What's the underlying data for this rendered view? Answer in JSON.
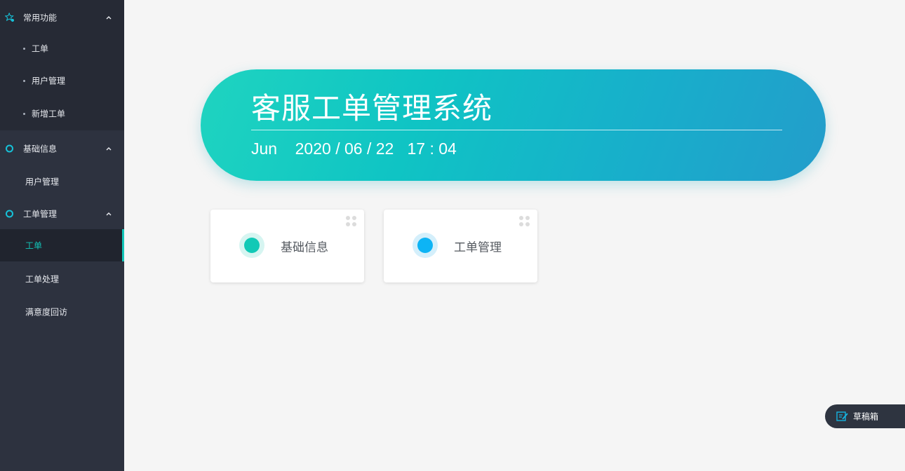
{
  "sidebar": {
    "groups": [
      {
        "label": "常用功能",
        "items": [
          "工单",
          "用户管理",
          "新增工单"
        ]
      },
      {
        "label": "基础信息",
        "items": [
          "用户管理"
        ]
      },
      {
        "label": "工单管理",
        "items": [
          "工单",
          "工单处理",
          "满意度回访"
        ],
        "active_item": "工单"
      }
    ],
    "accent_color": "#12c6b9",
    "background_color": "#2d323f"
  },
  "banner": {
    "title": "客服工单管理系统",
    "date": "Jun    2020 / 06 / 22   17 : 04",
    "gradient": [
      "#1fd4c0",
      "#239dcb"
    ]
  },
  "cards": [
    {
      "label": "基础信息",
      "icon": "teal-dot-icon",
      "color": "#12c9b6"
    },
    {
      "label": "工单管理",
      "icon": "blue-dot-icon",
      "color": "#0db4f5"
    }
  ],
  "draft_box": {
    "label": "草稿箱",
    "icon": "edit-note-icon"
  }
}
